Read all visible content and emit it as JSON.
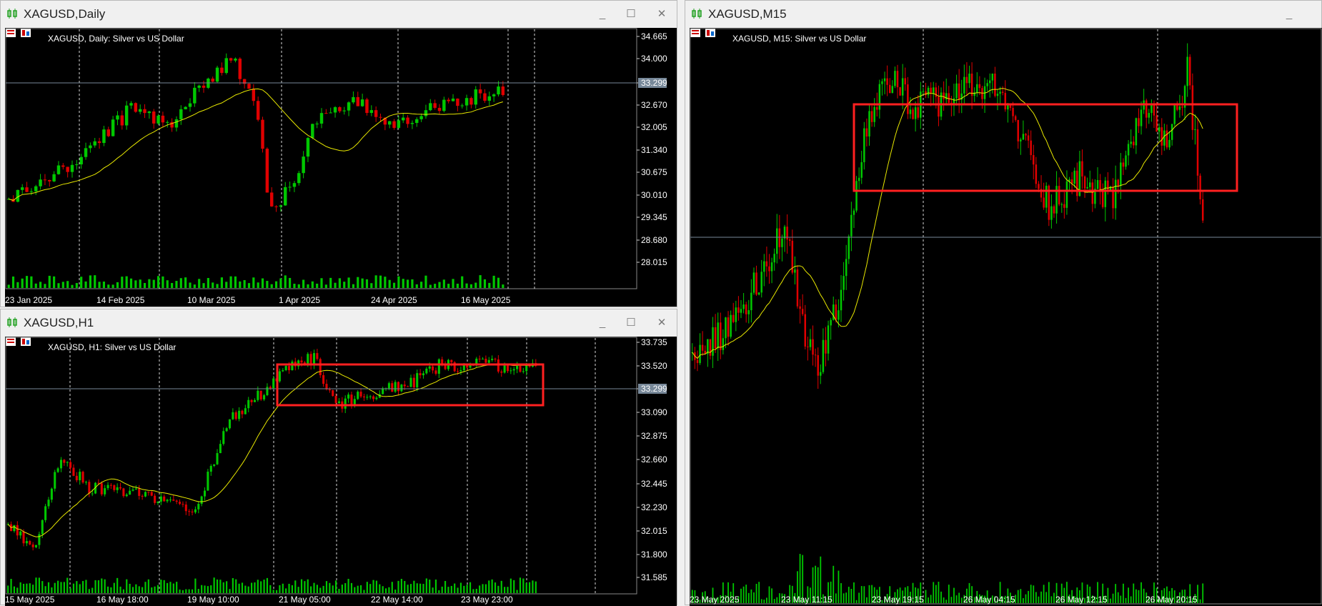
{
  "windows": {
    "daily": {
      "title": "XAGUSD,Daily",
      "chart_label": "XAGUSD, Daily:  Silver vs US Dollar",
      "price_ticks": [
        "34.665",
        "34.000",
        "33.299",
        "32.670",
        "32.005",
        "31.340",
        "30.675",
        "30.010",
        "29.345",
        "28.680",
        "28.015"
      ],
      "date_ticks": [
        "23 Jan 2025",
        "14 Feb 2025",
        "10 Mar 2025",
        "1 Apr 2025",
        "24 Apr 2025",
        "16 May 2025"
      ],
      "current_price": "33.299"
    },
    "h1": {
      "title": "XAGUSD,H1",
      "chart_label": "XAGUSD, H1:  Silver vs US Dollar",
      "price_ticks": [
        "33.735",
        "33.520",
        "33.299",
        "33.090",
        "32.875",
        "32.660",
        "32.445",
        "32.230",
        "32.015",
        "31.800",
        "31.585"
      ],
      "date_ticks": [
        "15 May 2025",
        "16 May 18:00",
        "19 May 10:00",
        "21 May 05:00",
        "22 May 14:00",
        "23 May 23:00"
      ],
      "current_price": "33.299"
    },
    "m15": {
      "title": "XAGUSD,M15",
      "chart_label": "XAGUSD, M15:  Silver vs US Dollar",
      "date_ticks": [
        "23 May 2025",
        "23 May 11:15",
        "23 May 19:15",
        "26 May 04:15",
        "26 May 12:15",
        "26 May 20:15"
      ]
    }
  },
  "window_buttons": {
    "minimize": "_",
    "maximize": "☐",
    "close": "✕"
  },
  "colors": {
    "bull": "#00c800",
    "bear": "#e00000",
    "ma": "#e8e800",
    "box": "#ff2020",
    "grid": "#ffffff",
    "price_line": "#778899"
  }
}
